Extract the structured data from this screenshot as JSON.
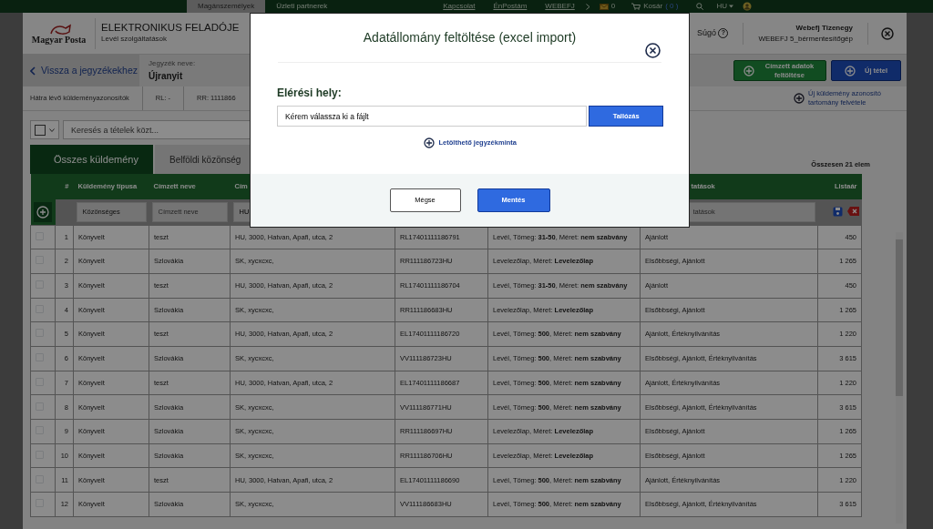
{
  "top_nav": {
    "tabs": [
      {
        "label": "Magánszemélyek",
        "selected": true
      },
      {
        "label": "Üzleti partnerek",
        "selected": false
      }
    ],
    "links": [
      "Kapcsolat",
      "ÉnPostám"
    ],
    "account": "WEBEFJ",
    "mail_count": "0",
    "cart_label": "Kosár",
    "cart_count": "( 0 )",
    "language": "HU"
  },
  "header": {
    "logo": "Magyar Posta",
    "title": "ELEKTRONIKUS FELADÓJE",
    "subtitle": "Levél szolgáltatások",
    "help": "Súgó",
    "help_icon": "?",
    "user_name": "Webefj Tizenegy",
    "user_account": "WEBEFJ 5_bérmentesítőgép"
  },
  "list_bar": {
    "back": "Vissza a jegyzékekhez",
    "name_label": "Jegyzék neve:",
    "name": "Újranyit",
    "buttons": [
      {
        "label": "Címzett adatok feltöltése",
        "kind": "green"
      },
      {
        "label": "Új tétel",
        "kind": "blue"
      }
    ]
  },
  "ids_bar": {
    "label": "Hátra lévő küldeményazonosítók",
    "ranges": [
      "RL: -",
      "RR: 1111866"
    ],
    "link": "Új küldemény azonosító tartomány felvétele"
  },
  "search": {
    "placeholder": "Keresés a tételek közt..."
  },
  "tabs": [
    {
      "label": "Összes küldemény",
      "selected": true
    },
    {
      "label": "Belföldi közönség",
      "selected": false
    }
  ],
  "total": "Összesen 21 elem",
  "table": {
    "headers": {
      "number": "#",
      "type": "Küldemény típusa",
      "recipient": "Címzett neve",
      "address": "Cím",
      "services": "tatások",
      "price": "Listaár"
    },
    "filters": {
      "type": "Közönséges",
      "recipient_placeholder": "Címzett neve",
      "address": "HU",
      "services_placeholder": "tatások"
    },
    "rows": [
      {
        "checked": false,
        "number": "1",
        "type": "Könyvelt",
        "recipient": "teszt",
        "address": "HU, 3000, Hatvan, Apafi, utca, 2",
        "id": "RL17401111186791",
        "content": "Levél, Tömeg: **31-50**, Méret: **nem szabvány**",
        "services": "Ajánlott",
        "price": "450"
      },
      {
        "checked": false,
        "number": "2",
        "type": "Könyvelt",
        "recipient": "Szlovákia",
        "address": "SK, xycxcxc,",
        "id": "RR111186723HU",
        "content": "Levelezőlap, Méret: **Levelezőlap**",
        "services": "Elsőbbségi, Ajánlott",
        "price": "1 265"
      },
      {
        "checked": false,
        "number": "3",
        "type": "Könyvelt",
        "recipient": "teszt",
        "address": "HU, 3000, Hatvan, Apafi, utca, 2",
        "id": "RL17401111186704",
        "content": "Levél, Tömeg: **31-50**, Méret: **nem szabvány**",
        "services": "Ajánlott",
        "price": "450"
      },
      {
        "checked": false,
        "number": "4",
        "type": "Könyvelt",
        "recipient": "Szlovákia",
        "address": "SK, xycxcxc,",
        "id": "RR111186683HU",
        "content": "Levelezőlap, Méret: **Levelezőlap**",
        "services": "Elsőbbségi, Ajánlott",
        "price": "1 265"
      },
      {
        "checked": false,
        "number": "5",
        "type": "Könyvelt",
        "recipient": "teszt",
        "address": "HU, 3000, Hatvan, Apafi, utca, 2",
        "id": "EL17401111186720",
        "content": "Levél, Tömeg: **500**, Méret: **nem szabvány**",
        "services": "Ajánlott, Értéknyilvánítás",
        "price": "1 220"
      },
      {
        "checked": false,
        "number": "6",
        "type": "Könyvelt",
        "recipient": "Szlovákia",
        "address": "SK, xycxcxc,",
        "id": "VV111186723HU",
        "content": "Levél, Tömeg: **500**, Méret: **nem szabvány**",
        "services": "Elsőbbségi, Ajánlott, Értéknyilvánítás",
        "price": "3 615"
      },
      {
        "checked": false,
        "number": "7",
        "type": "Könyvelt",
        "recipient": "teszt",
        "address": "HU, 3000, Hatvan, Apafi, utca, 2",
        "id": "EL17401111186687",
        "content": "Levél, Tömeg: **500**, Méret: **nem szabvány**",
        "services": "Ajánlott, Értéknyilvánítás",
        "price": "1 220"
      },
      {
        "checked": false,
        "number": "8",
        "type": "Könyvelt",
        "recipient": "Szlovákia",
        "address": "SK, xycxcxc,",
        "id": "VV111186771HU",
        "content": "Levél, Tömeg: **500**, Méret: **nem szabvány**",
        "services": "Elsőbbségi, Ajánlott, Értéknyilvánítás",
        "price": "3 615"
      },
      {
        "checked": false,
        "number": "9",
        "type": "Könyvelt",
        "recipient": "Szlovákia",
        "address": "SK, xycxcxc,",
        "id": "RR111186697HU",
        "content": "Levelezőlap, Méret: **Levelezőlap**",
        "services": "Elsőbbségi, Ajánlott",
        "price": "1 265"
      },
      {
        "checked": false,
        "number": "10",
        "type": "Könyvelt",
        "recipient": "Szlovákia",
        "address": "SK, xycxcxc,",
        "id": "RR111186706HU",
        "content": "Levelezőlap, Méret: **Levelezőlap**",
        "services": "Elsőbbségi, Ajánlott",
        "price": "1 265"
      },
      {
        "checked": false,
        "number": "11",
        "type": "Könyvelt",
        "recipient": "teszt",
        "address": "HU, 3000, Hatvan, Apafi, utca, 2",
        "id": "EL17401111186690",
        "content": "Levél, Tömeg: **500**, Méret: **nem szabvány**",
        "services": "Ajánlott, Értéknyilvánítás",
        "price": "1 220"
      },
      {
        "checked": false,
        "number": "12",
        "type": "Könyvelt",
        "recipient": "Szlovákia",
        "address": "SK, xycxcxc,",
        "id": "VV111186683HU",
        "content": "Levél, Tömeg: **500**, Méret: **nem szabvány**",
        "services": "Elsőbbségi, Ajánlott, Értéknyilvánítás",
        "price": "3 615"
      }
    ]
  },
  "modal": {
    "title": "Adatállomány feltöltése (excel import)",
    "field_label": "Elérési hely:",
    "field_value": "Kérem válassza ki a fájlt",
    "browse": "Tallózás",
    "link": "Letölthető jegyzékminta",
    "cancel": "Mégse",
    "save": "Mentés"
  }
}
